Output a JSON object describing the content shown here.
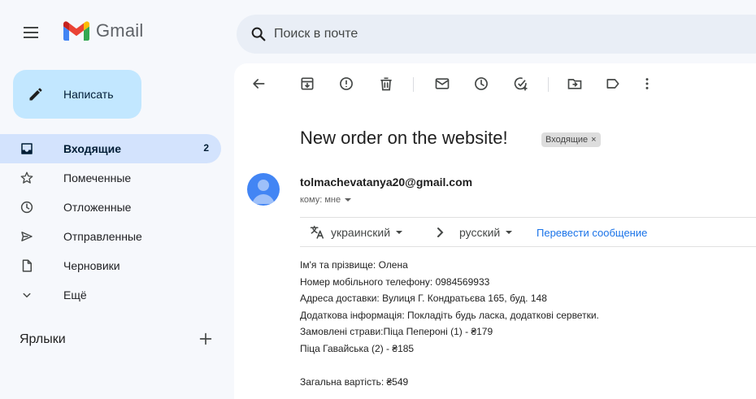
{
  "app": {
    "name": "Gmail"
  },
  "search": {
    "placeholder": "Поиск в почте"
  },
  "compose": {
    "label": "Написать"
  },
  "sidebar": {
    "items": [
      {
        "label": "Входящие",
        "icon": "inbox-icon",
        "count": "2",
        "active": true
      },
      {
        "label": "Помеченные",
        "icon": "star-icon"
      },
      {
        "label": "Отложенные",
        "icon": "clock-icon"
      },
      {
        "label": "Отправленные",
        "icon": "send-icon"
      },
      {
        "label": "Черновики",
        "icon": "draft-icon"
      },
      {
        "label": "Ещё",
        "icon": "chevron-down-icon"
      }
    ],
    "labels_title": "Ярлыки"
  },
  "toolbar": {
    "buttons": [
      "back-icon",
      "archive-icon",
      "report-spam-icon",
      "delete-icon",
      "mark-unread-icon",
      "snooze-icon",
      "add-task-icon",
      "move-to-icon",
      "label-icon",
      "more-icon"
    ]
  },
  "message": {
    "subject": "New order on the website!",
    "label_chip": "Входящие",
    "label_chip_close": "×",
    "sender": "tolmachevatanya20@gmail.com",
    "recipient": "кому: мне",
    "body": [
      "Ім'я та прізвище: Олена",
      "Номер мобільного телефону: 0984569933",
      "Адреса доставки: Вулиця Г. Кондратьєва 165, буд. 148",
      "Додаткова інформація: Покладіть будь ласка, додаткові серветки.",
      "Замовлені страви:Піца Пепероні (1) - ₴179",
      "Піца Гавайська (2) - ₴185",
      "",
      "Загальна вартість: ₴549"
    ]
  },
  "translate": {
    "source_lang": "украинский",
    "target_lang": "русский",
    "action": "Перевести сообщение"
  },
  "colors": {
    "background": "#f6f8fc",
    "compose": "#c2e7ff",
    "active_nav": "#d3e3fd",
    "link": "#1a73e8",
    "avatar": "#4285f4"
  }
}
